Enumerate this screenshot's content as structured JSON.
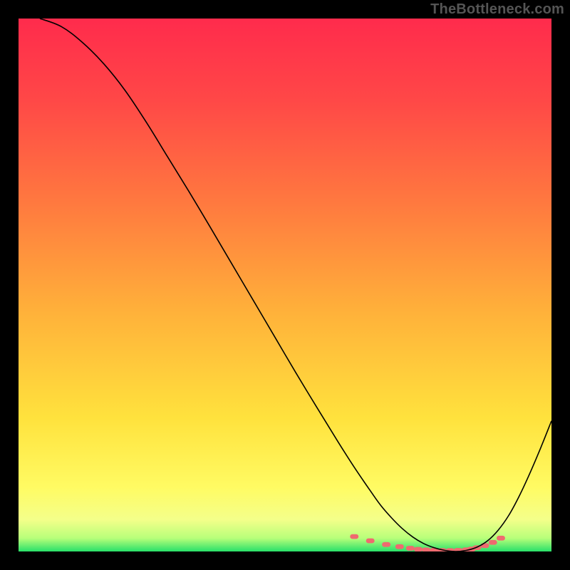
{
  "watermark": "TheBottleneck.com",
  "chart_data": {
    "type": "line",
    "title": "",
    "xlabel": "",
    "ylabel": "",
    "xlim": [
      0,
      100
    ],
    "ylim": [
      0,
      100
    ],
    "background_gradient": {
      "stops": [
        {
          "offset": 0.0,
          "color": "#ff2b4c"
        },
        {
          "offset": 0.15,
          "color": "#ff4747"
        },
        {
          "offset": 0.35,
          "color": "#ff7a3f"
        },
        {
          "offset": 0.55,
          "color": "#ffb13a"
        },
        {
          "offset": 0.75,
          "color": "#ffe23d"
        },
        {
          "offset": 0.88,
          "color": "#fffb63"
        },
        {
          "offset": 0.94,
          "color": "#f4ff8a"
        },
        {
          "offset": 0.975,
          "color": "#b8ff7a"
        },
        {
          "offset": 1.0,
          "color": "#28e06a"
        }
      ]
    },
    "series": [
      {
        "name": "bottleneck-curve",
        "stroke": "#000000",
        "x": [
          4,
          8,
          12,
          16,
          20,
          24,
          28,
          32,
          36,
          40,
          44,
          48,
          52,
          56,
          60,
          63,
          66,
          68,
          70,
          72,
          74,
          76,
          78,
          80,
          82,
          84,
          86,
          88,
          90,
          92,
          94,
          96,
          98,
          100
        ],
        "y": [
          100,
          98.5,
          95.5,
          91.5,
          86.5,
          80.5,
          74.0,
          67.5,
          60.8,
          54.0,
          47.2,
          40.4,
          33.6,
          27.0,
          20.5,
          15.8,
          11.4,
          8.6,
          6.3,
          4.3,
          2.7,
          1.5,
          0.7,
          0.2,
          0.0,
          0.2,
          0.8,
          2.0,
          4.0,
          6.8,
          10.5,
          14.8,
          19.5,
          24.5
        ]
      }
    ],
    "markers": {
      "name": "dashed-minimum",
      "color": "#ef6a6f",
      "shape": "rounded-dash",
      "x": [
        63,
        66,
        69,
        71.5,
        73.5,
        75,
        76.5,
        78,
        79.5,
        81,
        82.5,
        84,
        85,
        86,
        87.5,
        89,
        90.5
      ],
      "y": [
        2.8,
        2.0,
        1.3,
        0.9,
        0.6,
        0.4,
        0.28,
        0.2,
        0.16,
        0.16,
        0.2,
        0.3,
        0.45,
        0.7,
        1.1,
        1.7,
        2.5
      ]
    }
  }
}
